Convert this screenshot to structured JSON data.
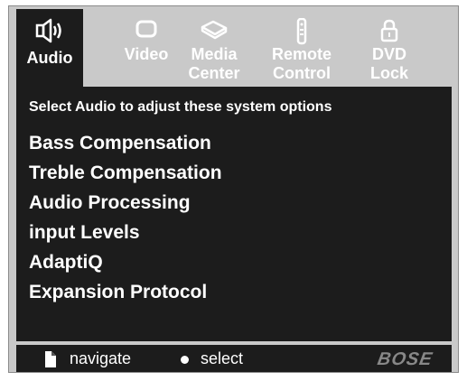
{
  "tabs": [
    {
      "label": "Audio",
      "icon": "speaker-icon",
      "active": true
    },
    {
      "label": "Video",
      "icon": "tv-icon",
      "active": false
    },
    {
      "label_lines": [
        "Media",
        "Center"
      ],
      "icon": "media-center-icon",
      "active": false
    },
    {
      "label_lines": [
        "Remote",
        "Control"
      ],
      "icon": "remote-icon",
      "active": false
    },
    {
      "label_lines": [
        "DVD",
        "Lock"
      ],
      "icon": "lock-icon",
      "active": false
    }
  ],
  "panel": {
    "instruction": "Select Audio to adjust these system options",
    "items": [
      "Bass Compensation",
      "Treble Compensation",
      "Audio Processing",
      "input Levels",
      "AdaptiQ",
      "Expansion Protocol"
    ]
  },
  "footer": {
    "navigate_label": "navigate",
    "select_label": "select",
    "brand": "BOSE"
  },
  "colors": {
    "frame": "#c9c9c9",
    "panel": "#1c1c1c",
    "text": "#ffffff",
    "logo": "#888888"
  }
}
